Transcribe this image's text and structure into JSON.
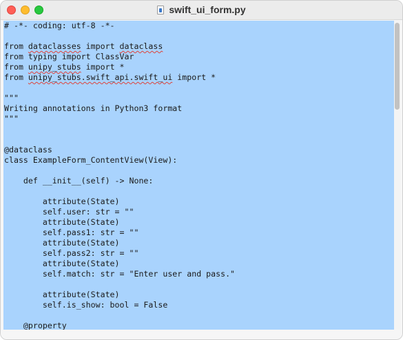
{
  "window": {
    "title": "swift_ui_form.py",
    "file_icon": "python-file-icon"
  },
  "editor": {
    "lines": [
      {
        "text": "# -*- coding: utf-8 -*-"
      },
      {
        "text": ""
      },
      {
        "parts": [
          {
            "t": "from "
          },
          {
            "t": "dataclasses",
            "sq": true
          },
          {
            "t": " import "
          },
          {
            "t": "dataclass",
            "sq": true
          }
        ]
      },
      {
        "text": "from typing import ClassVar"
      },
      {
        "parts": [
          {
            "t": "from "
          },
          {
            "t": "unipy_stubs",
            "sq": true
          },
          {
            "t": " import *"
          }
        ]
      },
      {
        "parts": [
          {
            "t": "from "
          },
          {
            "t": "unipy_stubs.swift_api.swift_ui",
            "sq": true
          },
          {
            "t": " import *"
          }
        ]
      },
      {
        "text": ""
      },
      {
        "text": "\"\"\""
      },
      {
        "text": "Writing annotations in Python3 format"
      },
      {
        "text": "\"\"\""
      },
      {
        "text": ""
      },
      {
        "text": ""
      },
      {
        "text": "@dataclass"
      },
      {
        "text": "class ExampleForm_ContentView(View):"
      },
      {
        "text": ""
      },
      {
        "text": "    def __init__(self) -> None:"
      },
      {
        "text": ""
      },
      {
        "text": "        attribute(State)"
      },
      {
        "text": "        self.user: str = \"\""
      },
      {
        "text": "        attribute(State)"
      },
      {
        "text": "        self.pass1: str = \"\""
      },
      {
        "text": "        attribute(State)"
      },
      {
        "text": "        self.pass2: str = \"\""
      },
      {
        "text": "        attribute(State)"
      },
      {
        "text": "        self.match: str = \"Enter user and pass.\""
      },
      {
        "text": ""
      },
      {
        "text": "        attribute(State)"
      },
      {
        "text": "        self.is_show: bool = False"
      },
      {
        "text": ""
      },
      {
        "text": "    @property"
      }
    ]
  }
}
